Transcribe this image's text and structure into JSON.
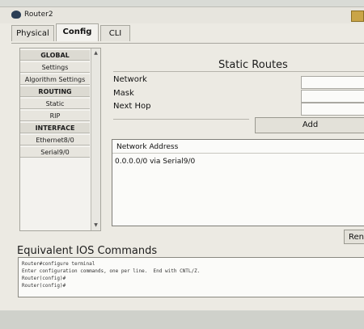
{
  "window": {
    "title": "Router2"
  },
  "tabs": [
    {
      "label": "Physical"
    },
    {
      "label": "Config"
    },
    {
      "label": "CLI"
    }
  ],
  "sidebar": {
    "items": [
      {
        "label": "GLOBAL",
        "header": true
      },
      {
        "label": "Settings",
        "header": false
      },
      {
        "label": "Algorithm Settings",
        "header": false
      },
      {
        "label": "ROUTING",
        "header": true
      },
      {
        "label": "Static",
        "header": false
      },
      {
        "label": "RIP",
        "header": false
      },
      {
        "label": "INTERFACE",
        "header": true
      },
      {
        "label": "Ethernet8/0",
        "header": false
      },
      {
        "label": "Serial9/0",
        "header": false
      }
    ]
  },
  "static_routes": {
    "title": "Static Routes",
    "network_label": "Network",
    "mask_label": "Mask",
    "next_hop_label": "Next Hop",
    "network_value": "",
    "mask_value": "",
    "next_hop_value": "",
    "add_label": "Add",
    "table_header": "Network Address",
    "rows": [
      "0.0.0.0/0 via Serial9/0"
    ],
    "remove_label": "Ren"
  },
  "ios": {
    "title": "Equivalent IOS Commands",
    "lines": [
      "Router#configure terminal",
      "Enter configuration commands, one per line.  End with CNTL/Z.",
      "Router(config)#",
      "Router(config)#"
    ]
  }
}
